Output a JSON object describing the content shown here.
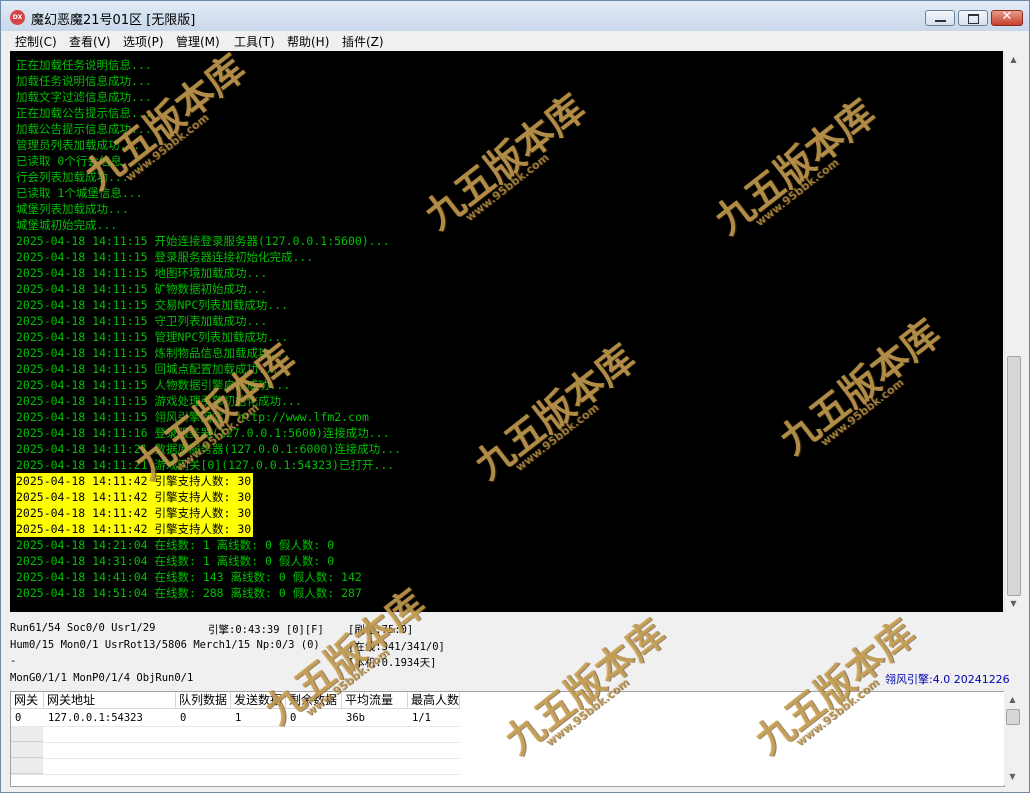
{
  "window": {
    "title": "魔幻恶魔21号01区 [无限版]",
    "icon_name": "app-logo-icon",
    "icon_text": "DX",
    "close_glyph": "✕"
  },
  "menu": [
    "控制(C)",
    "查看(V)",
    "选项(P)",
    "管理(M)",
    "工具(T)",
    "帮助(H)",
    "插件(Z)"
  ],
  "log": [
    {
      "text": "正在加载任务说明信息...",
      "hl": false
    },
    {
      "text": "加载任务说明信息成功...",
      "hl": false
    },
    {
      "text": "加载文字过滤信息成功...",
      "hl": false
    },
    {
      "text": "正在加载公告提示信息...",
      "hl": false
    },
    {
      "text": "加载公告提示信息成功...",
      "hl": false
    },
    {
      "text": "管理员列表加载成功...",
      "hl": false
    },
    {
      "text": "已读取 0个行会信息...",
      "hl": false
    },
    {
      "text": "行会列表加载成功...",
      "hl": false
    },
    {
      "text": "已读取 1个城堡信息...",
      "hl": false
    },
    {
      "text": "城堡列表加载成功...",
      "hl": false
    },
    {
      "text": "城堡城初始完成...",
      "hl": false
    },
    {
      "text": "2025-04-18 14:11:15 开始连接登录服务器(127.0.0.1:5600)...",
      "hl": false
    },
    {
      "text": "2025-04-18 14:11:15 登录服务器连接初始化完成...",
      "hl": false
    },
    {
      "text": "2025-04-18 14:11:15 地图环境加载成功...",
      "hl": false
    },
    {
      "text": "2025-04-18 14:11:15 矿物数据初始成功...",
      "hl": false
    },
    {
      "text": "2025-04-18 14:11:15 交易NPC列表加载成功...",
      "hl": false
    },
    {
      "text": "2025-04-18 14:11:15 守卫列表加载成功...",
      "hl": false
    },
    {
      "text": "2025-04-18 14:11:15 管理NPC列表加载成功...",
      "hl": false
    },
    {
      "text": "2025-04-18 14:11:15 炼制物品信息加载成功...",
      "hl": false
    },
    {
      "text": "2025-04-18 14:11:15 回城点配置加载成功...",
      "hl": false
    },
    {
      "text": "2025-04-18 14:11:15 人物数据引擎启动成功...",
      "hl": false
    },
    {
      "text": "2025-04-18 14:11:15 游戏处理引擎初始化成功...",
      "hl": false
    },
    {
      "text": "2025-04-18 14:11:15 翎风引擎网站: http://www.lfm2.com",
      "hl": false
    },
    {
      "text": "2025-04-18 14:11:16 登录服务器(127.0.0.1:5600)连接成功...",
      "hl": false
    },
    {
      "text": "2025-04-18 14:11:21 数据库服务器(127.0.0.1:6000)连接成功...",
      "hl": false
    },
    {
      "text": "2025-04-18 14:11:21 游戏网关[0](127.0.0.1:54323)已打开...",
      "hl": false
    },
    {
      "text": "2025-04-18 14:11:42 引擎支持人数: 30",
      "hl": true
    },
    {
      "text": "2025-04-18 14:11:42 引擎支持人数: 30",
      "hl": true
    },
    {
      "text": "2025-04-18 14:11:42 引擎支持人数: 30",
      "hl": true
    },
    {
      "text": "2025-04-18 14:11:42 引擎支持人数: 30",
      "hl": true
    },
    {
      "text": "2025-04-18 14:21:04 在线数: 1 离线数: 0 假人数: 0",
      "hl": false
    },
    {
      "text": "2025-04-18 14:31:04 在线数: 1 离线数: 0 假人数: 0",
      "hl": false
    },
    {
      "text": "2025-04-18 14:41:04 在线数: 143 离线数: 0 假人数: 142",
      "hl": false
    },
    {
      "text": "2025-04-18 14:51:04 在线数: 288 离线数: 0 假人数: 287",
      "hl": false
    }
  ],
  "status": {
    "l1": "Run61/54 Soc0/0 Usr1/29",
    "l2": "Hum0/15 Mon0/1 UsrRot13/5806 Merch1/15 Np:0/3 (0)",
    "l3": "-",
    "l4": "MonG0/1/1 MonP0/1/4 ObjRun0/1",
    "engine_time": "引擎:0:43:39 [0][F]",
    "refresh": "[刷怪:75:0]",
    "online": "[在线:341/341/0]",
    "local": "[本机:0.1934天]",
    "version": "翎风引擎:4.0 20241226"
  },
  "grid": {
    "headers": [
      "网关",
      "网关地址",
      "队列数据",
      "发送数据",
      "剩余数据",
      "平均流量",
      "最高人数"
    ],
    "rows": [
      [
        "0",
        "127.0.0.1:54323",
        "0",
        "1",
        "0",
        "36b",
        "1/1"
      ]
    ]
  },
  "watermark": {
    "main": "九五版本库",
    "sub": "www.95bbk.com"
  }
}
